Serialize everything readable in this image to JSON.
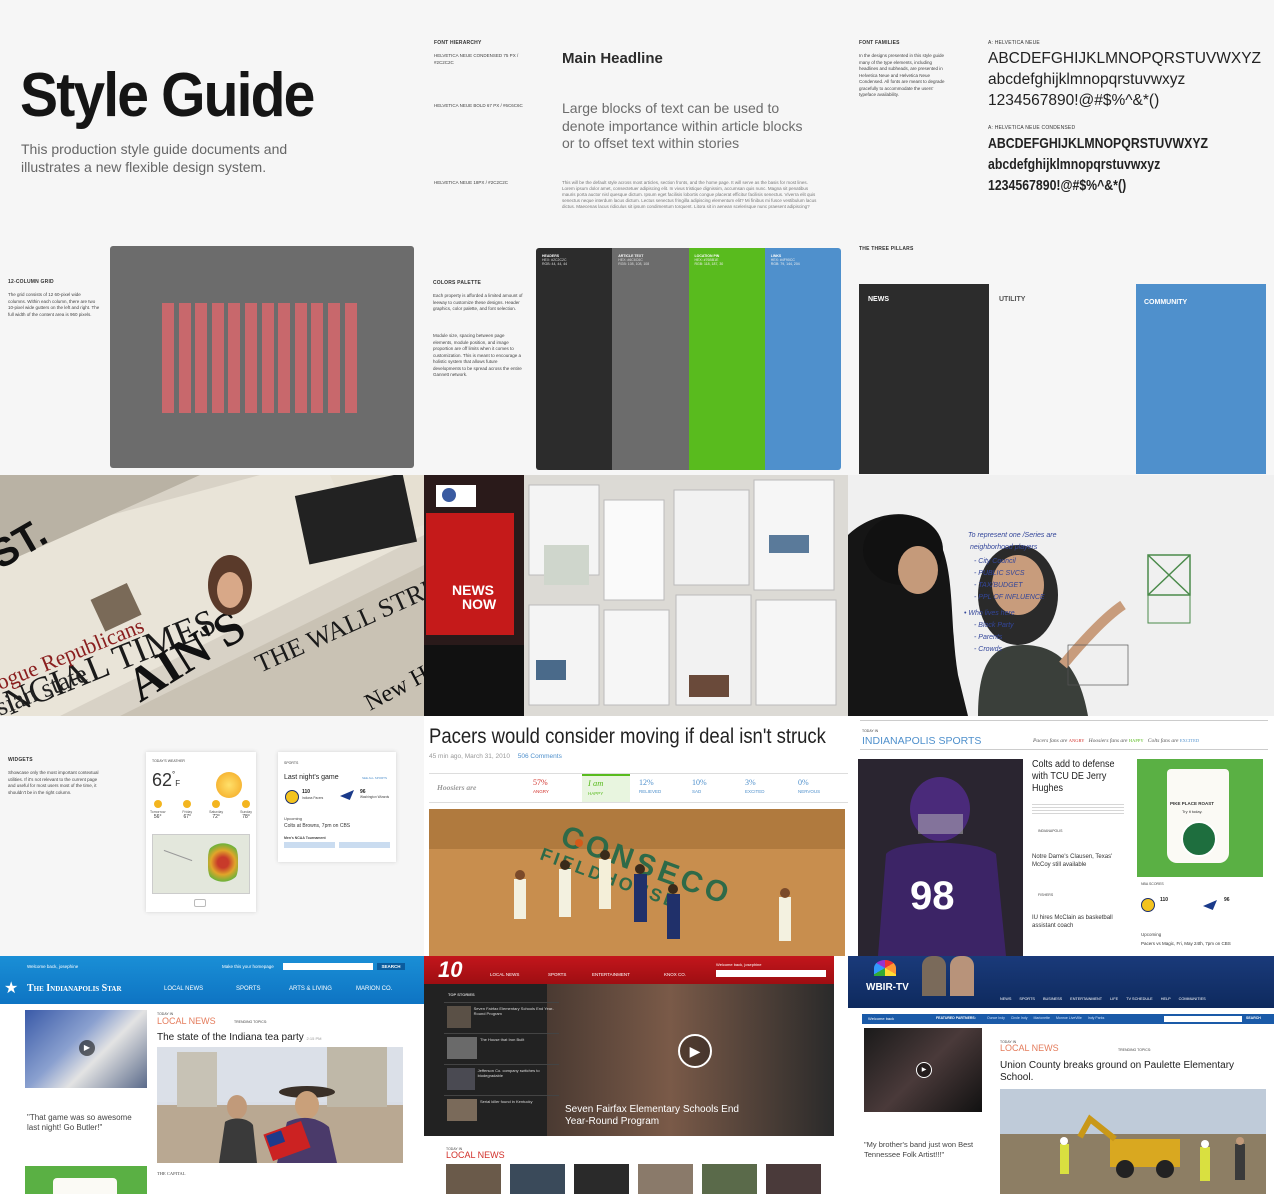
{
  "title": "Style Guide",
  "intro": "This production style guide documents and illustrates a new flexible design system.",
  "font_hierarchy": {
    "label": "FONT HIERARCHY",
    "rows": [
      {
        "spec": "HELVETICA NEUE CONDENSED 75 PX / #2C2C2C",
        "sample": "Main Headline"
      },
      {
        "spec": "HELVETICA NEUE BOLD 67 PX / #6C6C6C",
        "sample": "Large blocks of text can be used to denote importance within article blocks or to offset text within stories"
      },
      {
        "spec": "HELVETICA NEUE 18PX / #2C2C2C",
        "sample": "This will be the default style across most articles, section fronts, and the home page. It will serve as the basis for most lines. Lorem ipsum dolor amet, consectetuer adipiscing elit. In vivus tristique dignissim, accumsan quis nunc. Magna sit penatibus mauris porta auctor nisl quesque dictum. Ipsum eget facilisis lobortis congue placerat efficitur facilisis senectus. Viverra elit quis senectus neque interdum lacus dictum. Lectus senectus fringilla adipiscing elementum elit? Mi finibus mi fusce vestibulum lacus dictus. Maecenas lacus ridiculus sit ipsum condimentum torquent. Litora sit in aenean scelerisque nunc praesent adipiscing?"
      }
    ]
  },
  "font_families": {
    "label": "FONT FAMILIES",
    "note": "In the designs presented in this style guide many of the type elements, including headlines and subheads, are presented in Helvetica Neue and Helvetica Neue Condensed. All fonts are meant to degrade gracefully to accommodate the users' typeface availability.",
    "samples": [
      {
        "name": "A: HELVETICA NEUE",
        "upper": "ABCDEFGHIJKLMNOPQRSTUVWXYZ",
        "lower": "abcdefghijklmnopqrstuvwxyz",
        "nums": "1234567890!@#$%^&*()"
      },
      {
        "name": "A: HELVETICA NEUE CONDENSED",
        "upper": "ABCDEFGHIJKLMNOPQRSTUVWXYZ",
        "lower": "abcdefghijklmnopqrstuvwxyz",
        "nums": "1234567890!@#$%^&*()"
      }
    ]
  },
  "grid": {
    "label": "12-COLUMN GRID",
    "desc": "The grid consists of 12 60-pixel wide columns. Within each column, there are two 10-pixel wide gutters on the left and right. The full width of the content area is 960 pixels.",
    "columns": 12,
    "bg_color": "#6c6c6c",
    "col_color": "#c8686c"
  },
  "palette": {
    "label": "COLORS PALETTE",
    "desc1": "Each property is afforded a limited amount of leeway to customize these designs. Header graphics, color palette, and font selection.",
    "desc2": "Module size, spacing between page elements, module position, and image proportion are off limits when it comes to customization. This is meant to encourage a holistic system that allows future developments to be spread across the entire Gannett network.",
    "swatches": [
      {
        "name": "HEADERS",
        "hex": "HEX: #2C2C2C",
        "rgb": "RGB: 44, 44, 44",
        "color": "#2c2c2c"
      },
      {
        "name": "ARTICLE TEXT",
        "hex": "HEX: #6C6C6C",
        "rgb": "RGB: 108, 108, 108",
        "color": "#6c6c6c"
      },
      {
        "name": "LOCATION PIN",
        "hex": "HEX: #76BB1E",
        "rgb": "RGB: 118, 187, 30",
        "color": "#59bb1e"
      },
      {
        "name": "LINKS",
        "hex": "HEX: #4F90CC",
        "rgb": "RGB: 79, 144, 204",
        "color": "#4f90cc"
      }
    ]
  },
  "pillars": {
    "label": "THE THREE PILLARS",
    "items": [
      {
        "name": "NEWS",
        "color": "#2c2c2c",
        "text": "#ffffff"
      },
      {
        "name": "UTILITY",
        "color": "#ffffff",
        "text": "#444444"
      },
      {
        "name": "COMMUNITY",
        "color": "#4f90cc",
        "text": "#ffffff"
      }
    ]
  },
  "photos": {
    "newspapers": [
      "FINANCIAL TIMES",
      "THE WALL STREET",
      "New Hun",
      "FROM ST."
    ],
    "monitor_logo": "NEWS NOW",
    "whiteboard_notes": [
      "To represent one /Series are",
      "neighborhood players",
      "- City Council",
      "- PUBLIC SVCS",
      "- TAX/BUDGET",
      "- PPL OF INFLUENCE",
      "• Who lives here",
      "- Block Party",
      "- Parents",
      "- Crowds"
    ]
  },
  "widgets": {
    "label": "WIDGETS",
    "desc": "Showcase only the most important contextual utilities. If it's not relevant to the current page and useful for most users most of the time, it shouldn't be in the right column.",
    "weather_label": "TODAY'S WEATHER",
    "temp": "62",
    "unit": "F",
    "days": [
      {
        "day": "Tomorrow",
        "temp": "56°"
      },
      {
        "day": "Friday",
        "temp": "67°"
      },
      {
        "day": "Saturday",
        "temp": "72°"
      },
      {
        "day": "Sunday",
        "temp": "78°"
      }
    ],
    "sports_label": "SPORTS",
    "game_title": "Last night's game",
    "see_all": "SEE ALL SPORTS",
    "team1": "110",
    "team1_name": "Indiana Pacers",
    "team2": "96",
    "team2_name": "Washington Wizards",
    "upcoming": "Upcoming",
    "upcoming_game": "Colts at Browns, 7pm on CBS",
    "tournament": "Men's NCAA Tournament"
  },
  "pacers": {
    "headline": "Pacers would consider moving if deal isn't struck",
    "meta": "45 min ago, March 31, 2010",
    "comments": "506 Comments",
    "moods_prefix": "Hoosiers are",
    "moods": [
      {
        "pct": "57%",
        "mood": "ANGRY",
        "color": "#d2302a"
      },
      {
        "pct": "I am",
        "mood": "HAPPY",
        "color": "#59bb1e"
      },
      {
        "pct": "12%",
        "mood": "RELIEVED",
        "color": "#4f90cc"
      },
      {
        "pct": "10%",
        "mood": "SAD",
        "color": "#4f90cc"
      },
      {
        "pct": "3%",
        "mood": "EXCITED",
        "color": "#4f90cc"
      },
      {
        "pct": "0%",
        "mood": "NERVOUS",
        "color": "#4f90cc"
      }
    ],
    "court_text": "CONSECO FIELDHOUSE"
  },
  "indy_sports": {
    "kicker": "TODAY IN",
    "title": "INDIANAPOLIS SPORTS",
    "moods": [
      {
        "text": "Pacers fans are",
        "mood": "ANGRY"
      },
      {
        "text": "Hoosiers fans are",
        "mood": "HAPPY"
      },
      {
        "text": "Colts fans are",
        "mood": "EXCITED"
      }
    ],
    "story1_title": "Colts add to defense with TCU DE Jerry Hughes",
    "story1_meta": "INDIANAPOLIS",
    "story2_title": "Notre Dame's Clausen, Texas' McCoy still available",
    "story2_meta": "FISHERS",
    "story3_title": "IU hires McClain as basketball assistant coach",
    "jersey": "98",
    "ad_title": "PIKE PLACE ROAST",
    "ad_sub": "Try it today.",
    "nba_scores": "NBA SCORES",
    "score1": "110",
    "score2": "96",
    "upcoming": "Upcoming",
    "upcoming_game": "Pacers vs Magic, Fri, May 24th, 7pm on CBS"
  },
  "indystar": {
    "welcome": "Welcome back, josephine",
    "make_home": "Make this your homepage",
    "search": "SEARCH",
    "brand": "The Indianapolis Star",
    "nav": [
      "LOCAL NEWS",
      "SPORTS",
      "ARTS & LIVING",
      "MARION CO."
    ],
    "kicker": "TODAY IN",
    "section": "LOCAL NEWS",
    "trending": "TRENDING TOPICS:",
    "headline": "The state of the Indiana tea party",
    "time": "2:15 PM",
    "quote": "\"That game was so awesome last night! Go Butler!\"",
    "paper_mark": "THE CAPITAL"
  },
  "wusa": {
    "brand": "10",
    "nav": [
      "LOCAL NEWS",
      "SPORTS",
      "ENTERTAINMENT",
      "KNOX CO."
    ],
    "welcome": "Welcome back, josephine",
    "top_stories": "TOP STORIES",
    "stories": [
      "Seven Fairfax Elementary Schools End Year-Round Program",
      "The House that Iron Built",
      "Jefferson Co. company switches to biodegradable",
      "Serial killer found in Kentucky"
    ],
    "caption": "Seven Fairfax Elementary Schools End Year-Round Program",
    "kicker": "TODAY IN",
    "section": "LOCAL NEWS"
  },
  "wbir": {
    "brand": "WBIR-TV",
    "nav": [
      "NEWS",
      "SPORTS",
      "BUSINESS",
      "ENTERTAINMENT",
      "LIFE",
      "TV SCHEDULE",
      "HELP",
      "COMMUNITIES"
    ],
    "welcome": "Welcome back",
    "featured": "FEATURED PARTNERS:",
    "partners": [
      "Ounce Indy",
      "Circle Indy",
      "Marionette",
      "Monroe LiveVille",
      "Indy Parks"
    ],
    "search": "SEARCH",
    "kicker": "TODAY IN",
    "section": "LOCAL NEWS",
    "trending": "TRENDING TOPICS:",
    "headline": "Union County breaks ground on Paulette Elementary School.",
    "quote": "\"My brother's band just won Best Tennessee Folk Artist!!!\""
  },
  "colors": {
    "accent_blue": "#4f90cc",
    "nav_blue": "#1a8fd6",
    "green": "#59bb1e",
    "red": "#d2302a",
    "dark": "#2c2c2c",
    "grid_pink": "#c8686c"
  }
}
